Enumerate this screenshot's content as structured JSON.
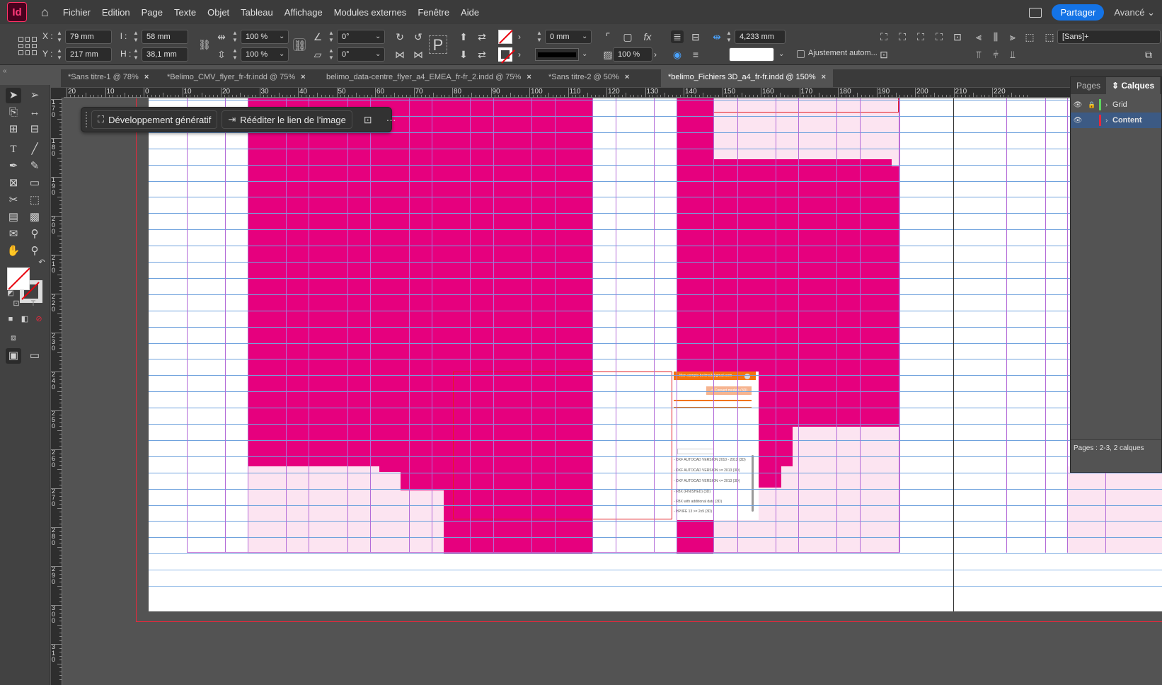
{
  "app": {
    "logo": "Id"
  },
  "menu": [
    "Fichier",
    "Edition",
    "Page",
    "Texte",
    "Objet",
    "Tableau",
    "Affichage",
    "Modules externes",
    "Fenêtre",
    "Aide"
  ],
  "header": {
    "share_label": "Partager",
    "workspace": "Avancé"
  },
  "control": {
    "x_label": "X :",
    "y_label": "Y :",
    "x": "79 mm",
    "y": "217 mm",
    "w_label": "l :",
    "h_label": "H :",
    "w": "58 mm",
    "h": "38,1 mm",
    "scale_x": "100 %",
    "scale_y": "100 %",
    "rotate": "0°",
    "shear": "0°",
    "stroke_weight": "0 mm",
    "opacity": "100 %",
    "spacing": "4,233 mm",
    "autofit_label": "Ajustement autom...",
    "style": "[Sans]+"
  },
  "tabs": [
    {
      "label": "*Sans titre-1 @ 78%"
    },
    {
      "label": "*Belimo_CMV_flyer_fr-fr.indd @ 75%"
    },
    {
      "label": "belimo_data-centre_flyer_a4_EMEA_fr-fr_2.indd @ 75%"
    },
    {
      "label": "*Sans titre-2 @ 50%"
    },
    {
      "label": "*belimo_Fichiers 3D_a4_fr-fr.indd @ 150%"
    }
  ],
  "ruler": {
    "h": [
      "20",
      "10",
      "0",
      "10",
      "20",
      "30",
      "40",
      "50",
      "60",
      "70",
      "80",
      "90",
      "100",
      "110",
      "120",
      "130",
      "140",
      "150",
      "160",
      "170",
      "180",
      "190",
      "200",
      "210",
      "220"
    ],
    "v": [
      "170",
      "180",
      "190",
      "200",
      "210",
      "220",
      "230",
      "240",
      "250",
      "260",
      "270",
      "280",
      "290",
      "300",
      "310"
    ]
  },
  "context_bar": {
    "generative_label": "Développement génératif",
    "relink_label": "Rééditer le lien de l’image",
    "more_label": "···"
  },
  "layers_panel": {
    "tab_pages": "Pages",
    "tab_layers": "Calques",
    "layers": [
      {
        "name": "Grid",
        "color": "#5cd65c"
      },
      {
        "name": "Content",
        "color": "#e8283c"
      }
    ],
    "footer": "Pages : 2-3, 2 calques"
  },
  "embedded_screenshot": {
    "bar_text": "Mon compte     belimo3@gmail.com",
    "button_text": "⚠ Convert models (3D)",
    "items": [
      "DXF AUTOCAD VERSION 2010 - 2012 (3D)",
      "DXF AUTOCAD VERSION >= 2013 (3D)",
      "DXF AUTOCAD VERSION <= 2013 (3D)",
      "FBX (FINISHED) (3D)",
      "FBX with additional data (3D)",
      "HP/IFE 13 >= 2x9 (3D)"
    ]
  },
  "colors": {
    "magenta": "#e6007e",
    "accent_blue": "#1473e6"
  }
}
